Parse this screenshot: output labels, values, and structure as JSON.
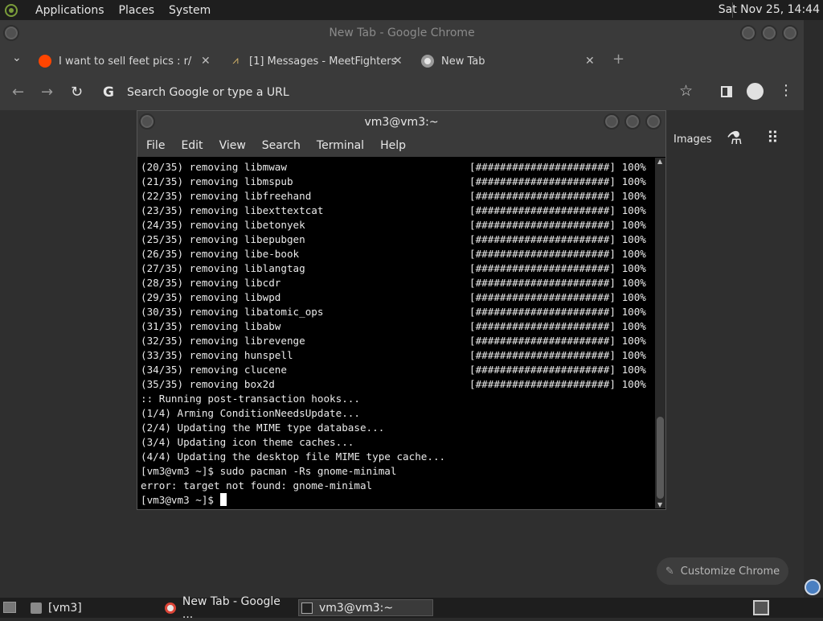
{
  "top_panel": {
    "menus": [
      "Applications",
      "Places",
      "System"
    ],
    "clock": "Sat Nov 25, 14:44"
  },
  "chrome": {
    "window_title": "New Tab - Google Chrome",
    "tabs": [
      {
        "label": "I want to sell feet pics : r/side",
        "icon": "reddit-icon"
      },
      {
        "label": "[1] Messages - MeetFighters",
        "icon": "meetfighters-icon"
      },
      {
        "label": "New Tab",
        "icon": "chrome-icon"
      }
    ],
    "omnibox_placeholder": "Search Google or type a URL",
    "ntp_images_label": "Images",
    "customize_label": "Customize Chrome"
  },
  "terminal": {
    "title": "vm3@vm3:~",
    "menu": [
      "File",
      "Edit",
      "View",
      "Search",
      "Terminal",
      "Help"
    ],
    "removals": [
      {
        "step": "(20/35)",
        "pkg": "libmwaw"
      },
      {
        "step": "(21/35)",
        "pkg": "libmspub"
      },
      {
        "step": "(22/35)",
        "pkg": "libfreehand"
      },
      {
        "step": "(23/35)",
        "pkg": "libexttextcat"
      },
      {
        "step": "(24/35)",
        "pkg": "libetonyek"
      },
      {
        "step": "(25/35)",
        "pkg": "libepubgen"
      },
      {
        "step": "(26/35)",
        "pkg": "libe-book"
      },
      {
        "step": "(27/35)",
        "pkg": "liblangtag"
      },
      {
        "step": "(28/35)",
        "pkg": "libcdr"
      },
      {
        "step": "(29/35)",
        "pkg": "libwpd"
      },
      {
        "step": "(30/35)",
        "pkg": "libatomic_ops"
      },
      {
        "step": "(31/35)",
        "pkg": "libabw"
      },
      {
        "step": "(32/35)",
        "pkg": "librevenge"
      },
      {
        "step": "(33/35)",
        "pkg": "hunspell"
      },
      {
        "step": "(34/35)",
        "pkg": "clucene"
      },
      {
        "step": "(35/35)",
        "pkg": "box2d"
      }
    ],
    "progress_bar": "[######################]",
    "progress_pct": "100%",
    "tail_lines": [
      ":: Running post-transaction hooks...",
      "(1/4) Arming ConditionNeedsUpdate...",
      "(2/4) Updating the MIME type database...",
      "(3/4) Updating icon theme caches...",
      "(4/4) Updating the desktop file MIME type cache...",
      "[vm3@vm3 ~]$ sudo pacman -Rs gnome-minimal",
      "error: target not found: gnome-minimal"
    ],
    "prompt": "[vm3@vm3 ~]$ "
  },
  "taskbar": {
    "items": [
      "[vm3]",
      "New Tab - Google ...",
      "vm3@vm3:~"
    ]
  }
}
